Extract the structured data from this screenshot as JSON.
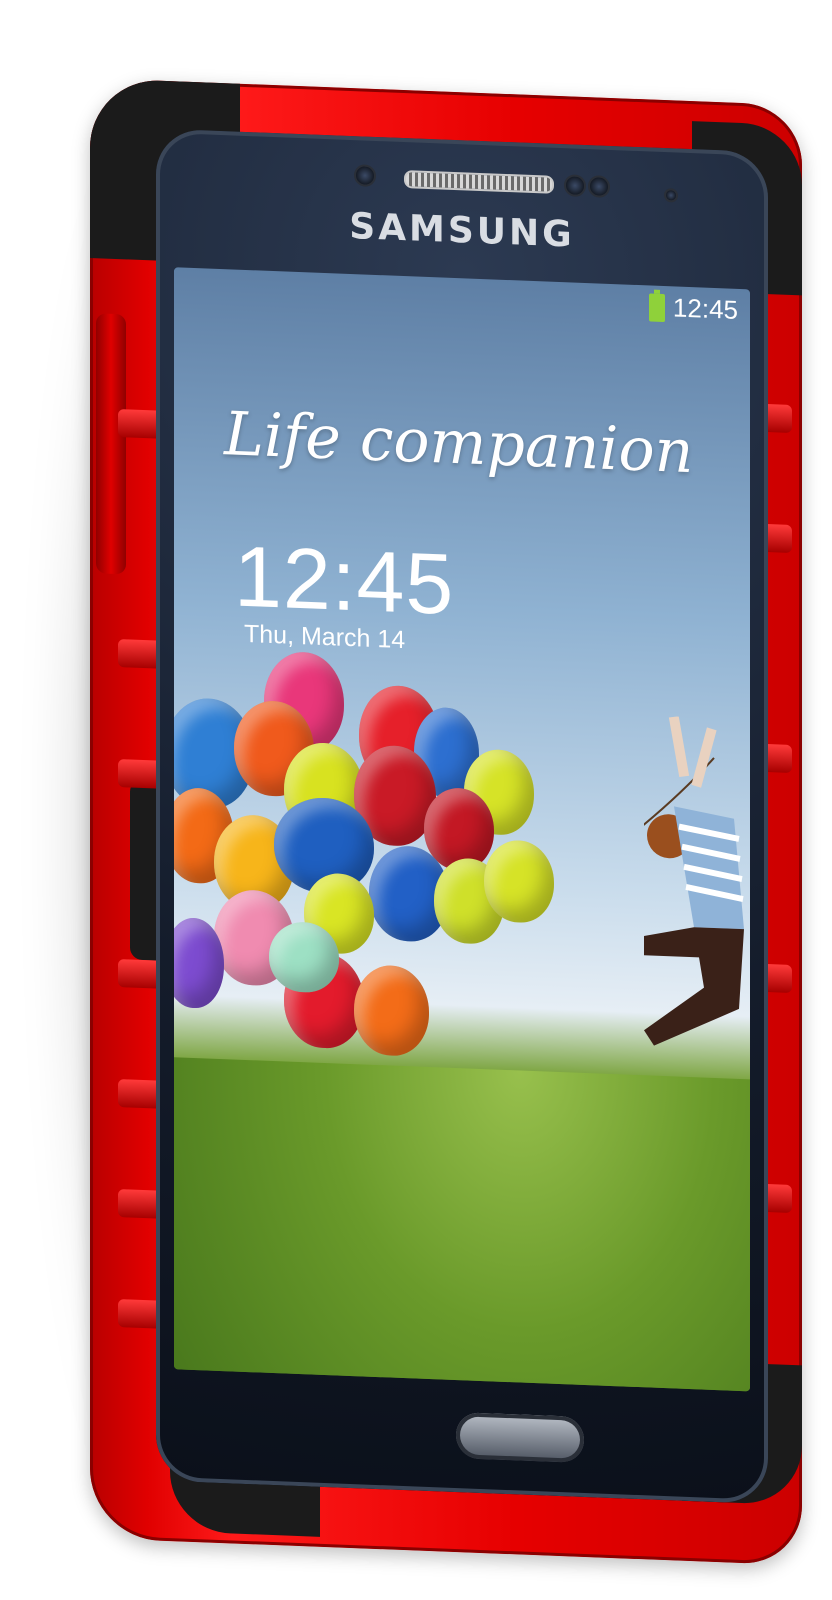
{
  "device": {
    "brand": "SAMSUNG",
    "case_color": "#e00000",
    "bumper_color": "#1b1b1b"
  },
  "screen": {
    "status_time": "12:45",
    "battery_icon": "battery-icon",
    "tagline": "Life companion",
    "clock": "12:45",
    "date": "Thu, March 14"
  }
}
